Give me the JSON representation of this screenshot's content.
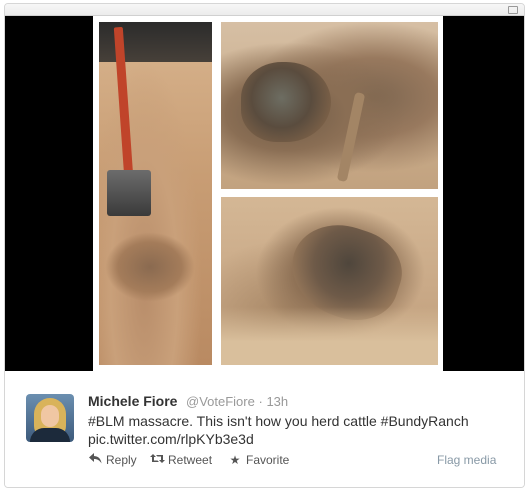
{
  "tweet": {
    "author_name": "Michele Fiore",
    "handle": "@VoteFiore",
    "separator": "·",
    "time": "13h",
    "text_line1": "#BLM massacre. This isn't how you herd cattle #BundyRanch",
    "text_line2": "pic.twitter.com/rlpKYb3e3d"
  },
  "actions": {
    "reply_label": "Reply",
    "retweet_label": "Retweet",
    "favorite_label": "Favorite",
    "flag_label": "Flag media",
    "reply_icon": "reply-arrow-icon",
    "retweet_icon": "retweet-icon",
    "favorite_icon": "star-icon"
  },
  "colors": {
    "name": "#333333",
    "handle": "#999999",
    "flag": "#8899a6",
    "media_background": "#000000"
  }
}
